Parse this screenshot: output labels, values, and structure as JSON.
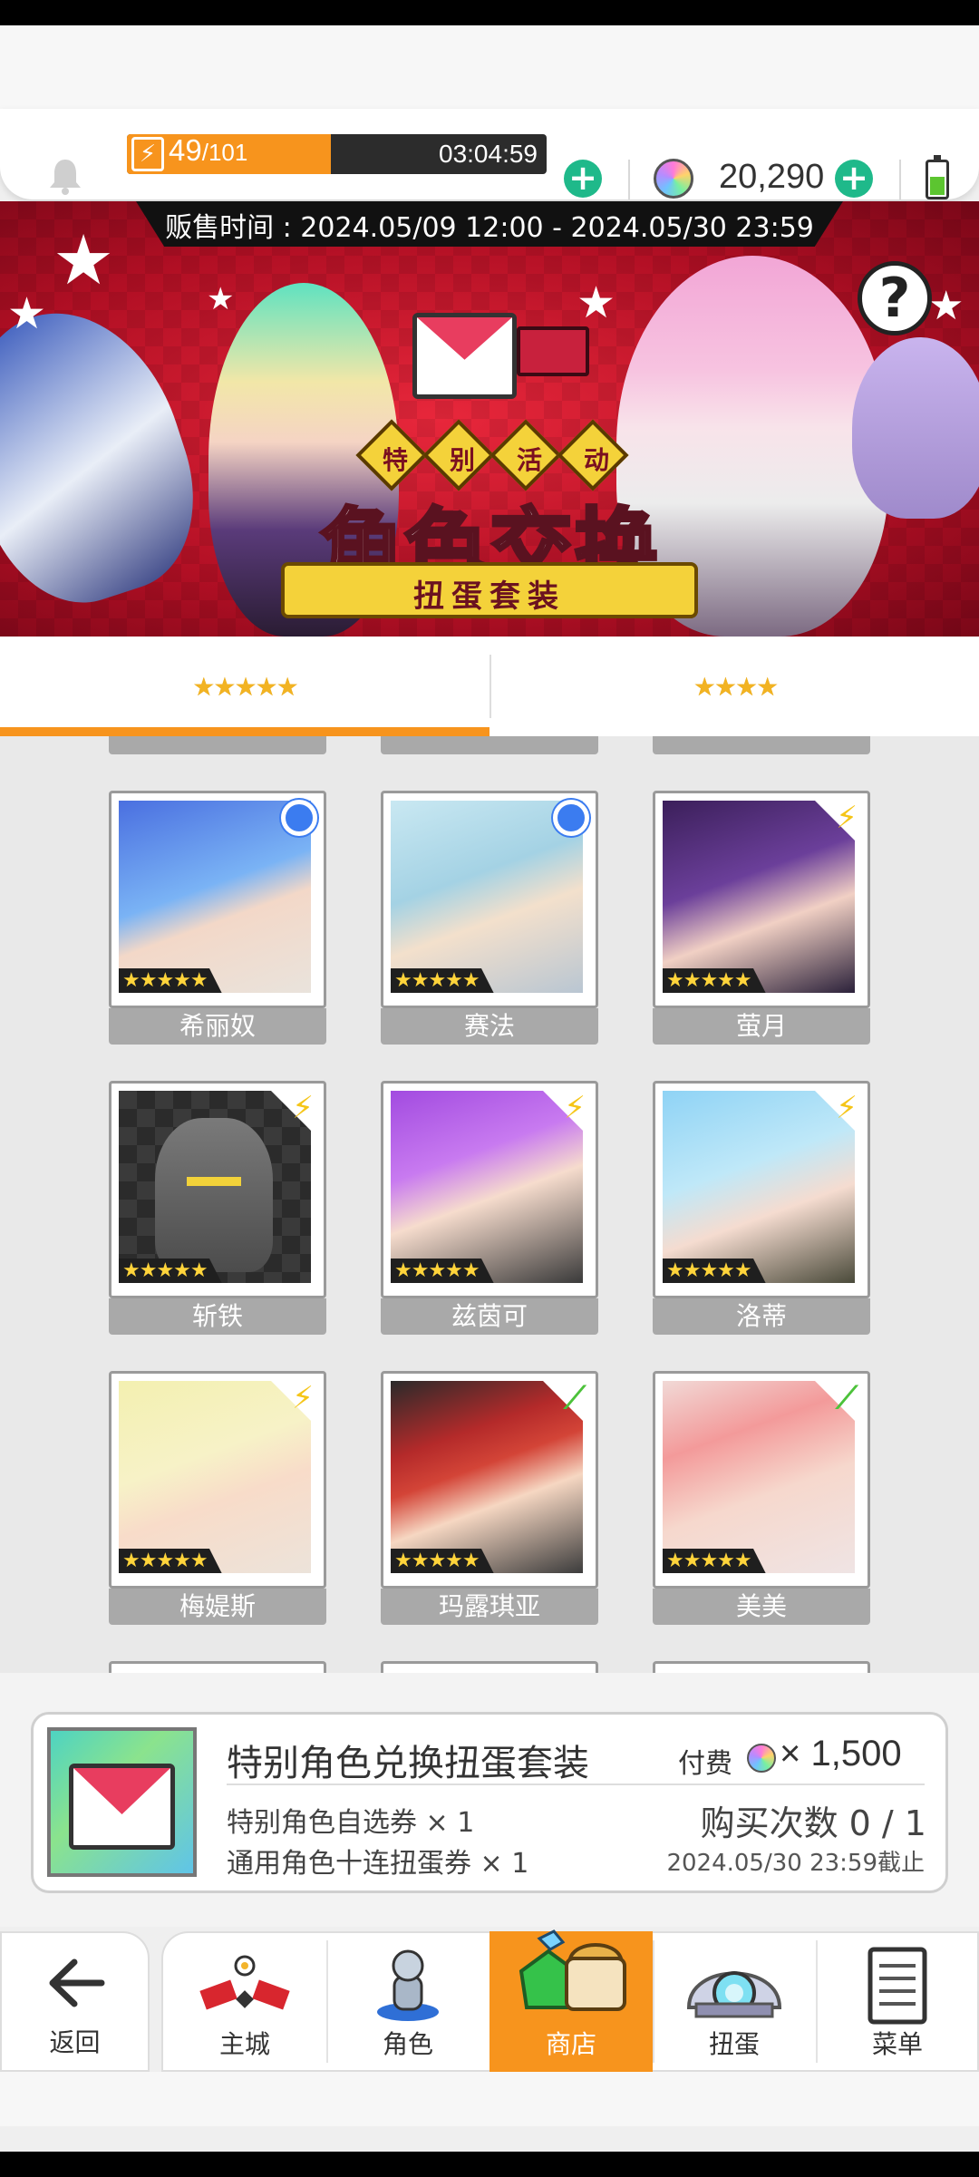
{
  "hud": {
    "stamina_current": "49",
    "stamina_max": "/101",
    "stamina_fraction": 0.485,
    "stamina_timer": "03:04:59",
    "gems": "20,290",
    "colors": {
      "stamina": "#f7941d",
      "plus": "#1fb98a"
    }
  },
  "banner": {
    "sale_time": "贩售时间 : 2024.05/09 12:00 - 2024.05/30 23:59",
    "badges": [
      "特",
      "别",
      "活",
      "动"
    ],
    "title": "角色交换",
    "subtitle": "扭蛋套装",
    "help_symbol": "?"
  },
  "tabs": [
    {
      "label": "★★★★★",
      "active": true
    },
    {
      "label": "★★★★",
      "active": false
    }
  ],
  "cards": [
    {
      "name": "希丽奴",
      "stars": "★★★★★",
      "badge": "circle",
      "badge_color": "#3b7cf0"
    },
    {
      "name": "赛法",
      "stars": "★★★★★",
      "badge": "circle",
      "badge_color": "#3b7cf0"
    },
    {
      "name": "萤月",
      "stars": "★★★★★",
      "badge": "bolt",
      "badge_color": "#f5c518"
    },
    {
      "name": "斩铁",
      "stars": "★★★★★",
      "badge": "bolt",
      "badge_color": "#f5c518"
    },
    {
      "name": "兹茵可",
      "stars": "★★★★★",
      "badge": "bolt",
      "badge_color": "#f5c518"
    },
    {
      "name": "洛蒂",
      "stars": "★★★★★",
      "badge": "bolt",
      "badge_color": "#f5c518"
    },
    {
      "name": "梅媞斯",
      "stars": "★★★★★",
      "badge": "bolt",
      "badge_color": "#f5c518"
    },
    {
      "name": "玛露琪亚",
      "stars": "★★★★★",
      "badge": "leaf",
      "badge_color": "#4cc23a"
    },
    {
      "name": "美美",
      "stars": "★★★★★",
      "badge": "leaf",
      "badge_color": "#4cc23a"
    }
  ],
  "offer": {
    "title": "特别角色兑换扭蛋套装",
    "item1": "特别角色自选券 × 1",
    "item2": "通用角色十连扭蛋券 × 1",
    "price_label": "付费",
    "price": "× 1,500",
    "buy_count": "购买次数 0 / 1",
    "deadline": "2024.05/30 23:59截止"
  },
  "nav": {
    "back": "返回",
    "items": [
      "主城",
      "角色",
      "商店",
      "扭蛋",
      "菜单"
    ],
    "active": "商店",
    "active_color": "#f7941d"
  }
}
